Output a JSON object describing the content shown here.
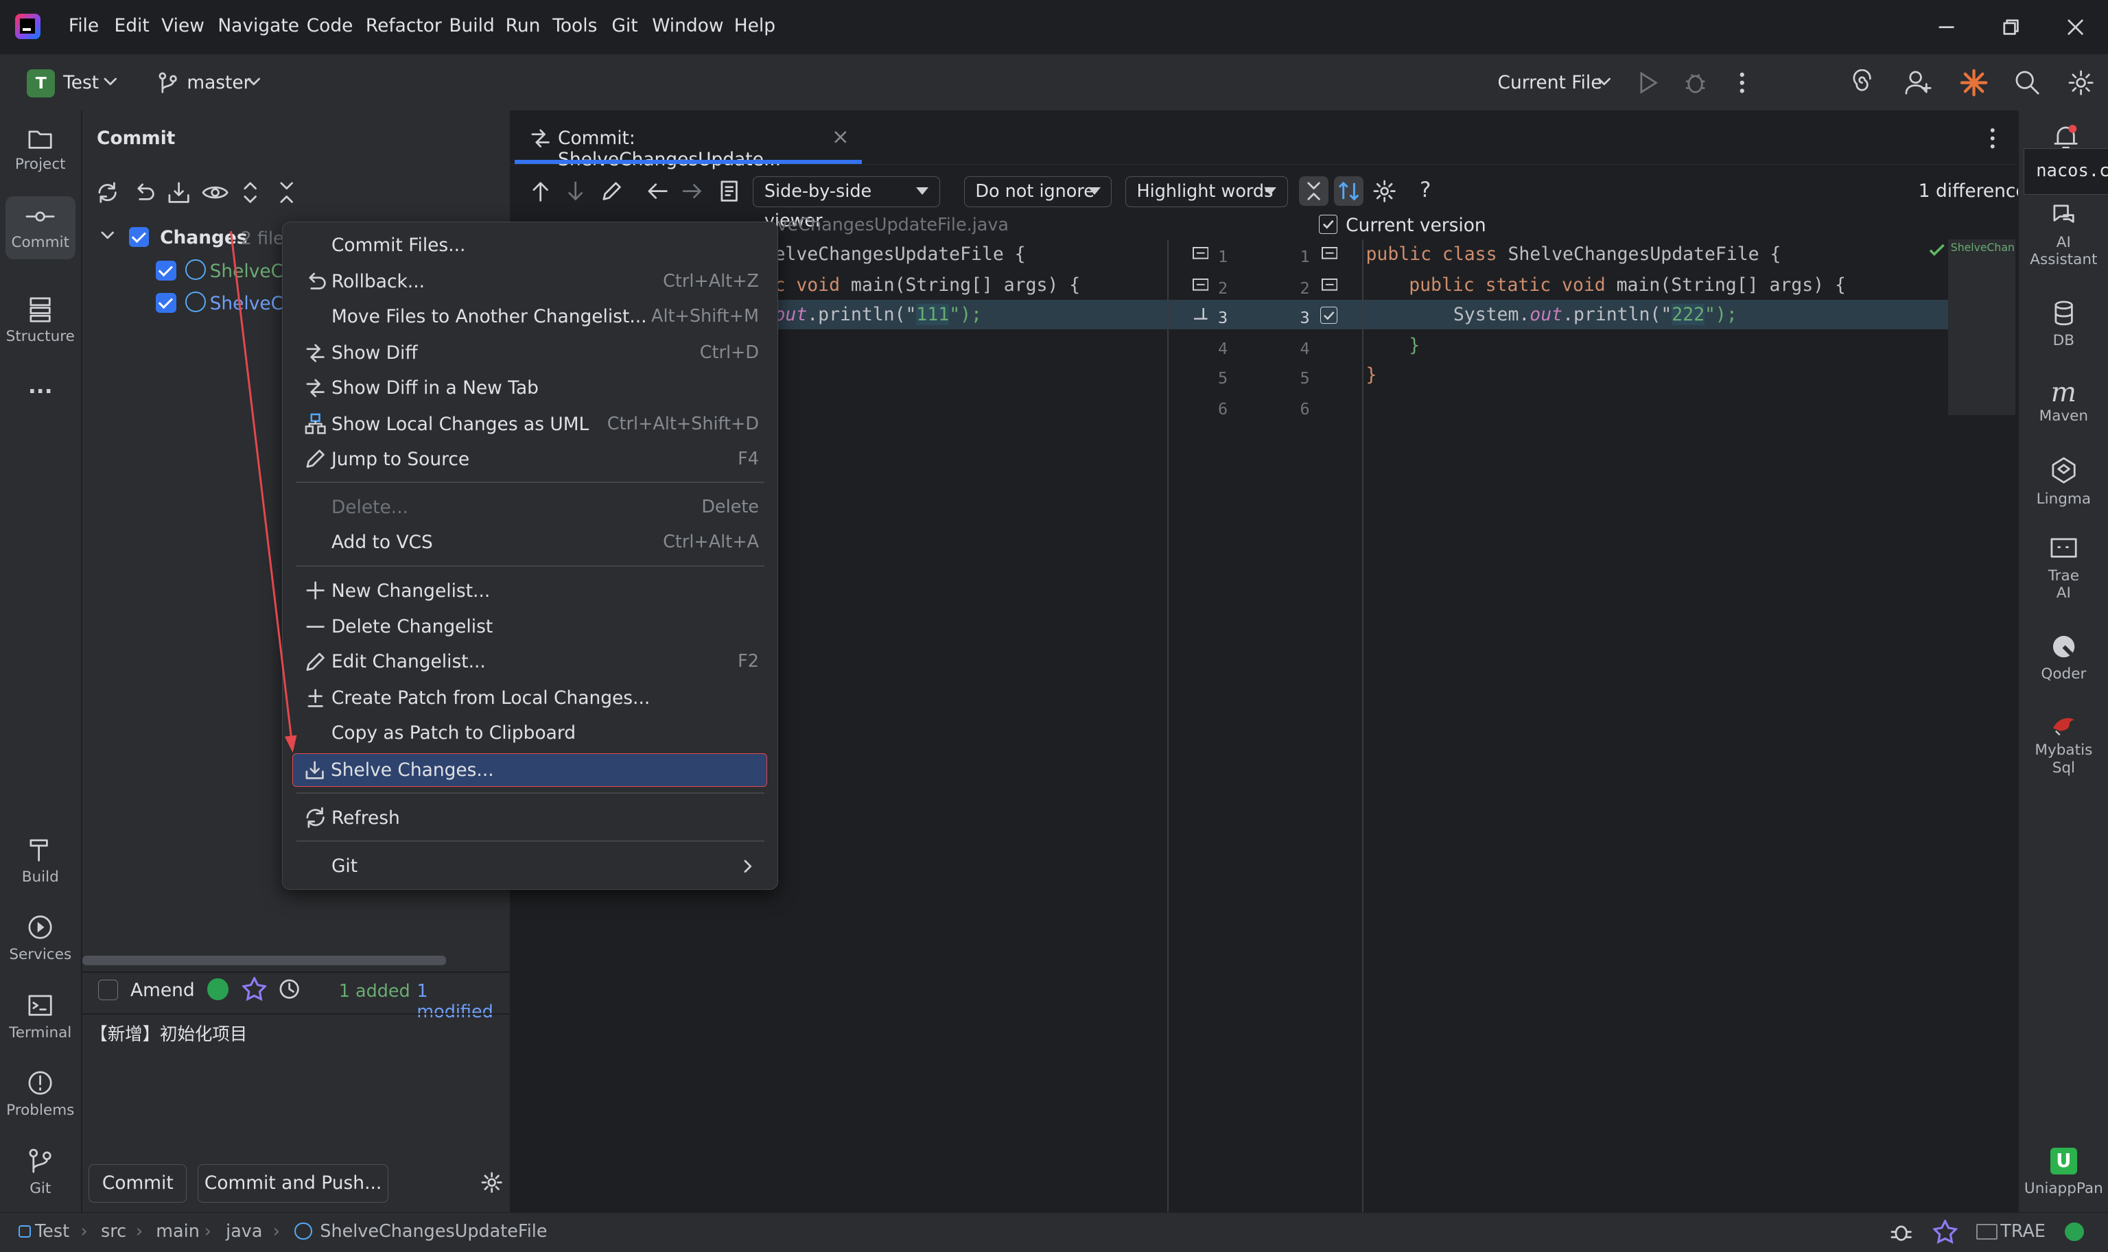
{
  "menubar": {
    "items": [
      "File",
      "Edit",
      "View",
      "Navigate",
      "Code",
      "Refactor",
      "Build",
      "Run",
      "Tools",
      "Git",
      "Window",
      "Help"
    ]
  },
  "toolbar": {
    "project_initial": "T",
    "project_name": "Test",
    "branch": "master",
    "run_config": "Current File"
  },
  "left_tools": {
    "project": "Project",
    "commit": "Commit",
    "structure": "Structure",
    "more": "...",
    "build": "Build",
    "services": "Services",
    "terminal": "Terminal",
    "problems": "Problems",
    "git": "Git"
  },
  "commit_panel": {
    "title": "Commit",
    "changes_label": "Changes",
    "changes_count": "2 files",
    "file1": "ShelveCh",
    "file2": "ShelveCh",
    "amend_label": "Amend",
    "added": "1 added",
    "modified": "1 modified",
    "message": "【新增】初始化项目",
    "commit_button": "Commit",
    "commit_push_button": "Commit and Push..."
  },
  "editor": {
    "tab_title": "Commit: ShelveChangesUpdate...",
    "viewer_mode": "Side-by-side viewer",
    "ignore_mode": "Do not ignore",
    "highlight_mode": "Highlight words",
    "differences": "1 difference",
    "left_file_title": "veChangesUpdateFile.java",
    "right_title": "Current version",
    "left_code": {
      "line1": "elveChangesUpdateFile {",
      "line2_kw": "c void ",
      "line2_rest": "main(String[] args) {",
      "line3_it": "out",
      "line3_pre": ".println(\"",
      "line3_str": "111",
      "line3_post": "\");"
    },
    "right_code": {
      "line1_kw": "public class ",
      "line1_rest": "ShelveChangesUpdateFile {",
      "line2_kw": "public static void ",
      "line2_rest": "main(String[] args) {",
      "line3_pre": "System.",
      "line3_it": "out",
      "line3_mid": ".println(\"",
      "line3_str": "222",
      "line3_post": "\");",
      "line4": "}",
      "line5": "}"
    },
    "left_line_numbers": [
      "1",
      "2",
      "3",
      "4",
      "5",
      "6"
    ],
    "right_line_numbers": [
      "1",
      "2",
      "3",
      "4",
      "5",
      "6"
    ],
    "minimap_label": "ShelveChan"
  },
  "right_tools": {
    "popup": "nacos.c",
    "ai_assistant_1": "AI",
    "ai_assistant_2": "Assistant",
    "db": "DB",
    "maven": "Maven",
    "lingma": "Lingma",
    "trae_1": "Trae",
    "trae_2": "AI",
    "qoder": "Qoder",
    "mybatis_1": "Mybatis",
    "mybatis_2": "Sql",
    "uniapp": "UniappPan"
  },
  "context_menu": {
    "commit_files": "Commit Files...",
    "rollback": "Rollback...",
    "rollback_sc": "Ctrl+Alt+Z",
    "move_files": "Move Files to Another Changelist...",
    "move_files_sc": "Alt+Shift+M",
    "show_diff": "Show Diff",
    "show_diff_sc": "Ctrl+D",
    "show_diff_tab": "Show Diff in a New Tab",
    "show_uml": "Show Local Changes as UML",
    "show_uml_sc": "Ctrl+Alt+Shift+D",
    "jump_source": "Jump to Source",
    "jump_source_sc": "F4",
    "delete": "Delete...",
    "delete_sc": "Delete",
    "add_vcs": "Add to VCS",
    "add_vcs_sc": "Ctrl+Alt+A",
    "new_changelist": "New Changelist...",
    "delete_changelist": "Delete Changelist",
    "edit_changelist": "Edit Changelist...",
    "edit_changelist_sc": "F2",
    "create_patch": "Create Patch from Local Changes...",
    "copy_patch": "Copy as Patch to Clipboard",
    "shelve": "Shelve Changes...",
    "refresh": "Refresh",
    "git": "Git"
  },
  "statusbar": {
    "crumbs": [
      "Test",
      "src",
      "main",
      "java",
      "ShelveChangesUpdateFile"
    ],
    "trae": "TRAE"
  },
  "colors": {
    "accent": "#3574f0",
    "selection_border": "#e5484d",
    "added": "#6aab73",
    "modified": "#6f9ef8"
  }
}
